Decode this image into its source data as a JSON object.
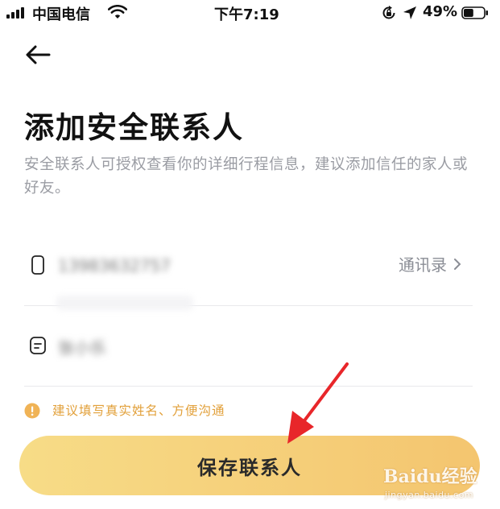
{
  "status_bar": {
    "carrier": "中国电信",
    "time": "下午7:19",
    "battery_percent": "49%",
    "battery_level": 0.49,
    "icons": [
      "signal-bars-icon",
      "wifi-icon",
      "rotation-lock-icon",
      "location-arrow-icon",
      "battery-icon"
    ]
  },
  "nav": {
    "back_icon": "back-arrow-icon"
  },
  "page": {
    "title": "添加安全联系人",
    "description": "安全联系人可授权查看你的详细行程信息，建议添加信任的家人或好友。"
  },
  "form": {
    "phone": {
      "icon": "phone-icon",
      "value": "13983632757"
    },
    "contacts_link": {
      "label": "通讯录",
      "icon": "chevron-right-icon"
    },
    "name": {
      "icon": "name-card-icon",
      "value": "张小乐"
    }
  },
  "tip": {
    "icon": "warning-icon",
    "text": "建议填写真实姓名、方便沟通"
  },
  "actions": {
    "save_label": "保存联系人"
  },
  "colors": {
    "accent_gradient_start": "#f7dc87",
    "accent_gradient_end": "#f4c56f",
    "tip": "#e2a03a",
    "annotation_arrow": "#e8262a"
  },
  "watermark": {
    "brand": "Baidu经验",
    "sub": "jingyan.baidu.com"
  }
}
